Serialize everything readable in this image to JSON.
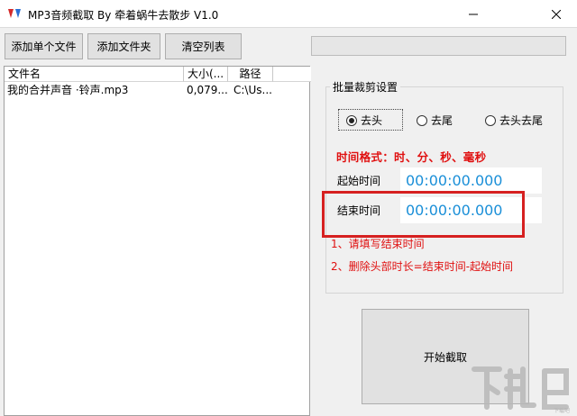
{
  "window": {
    "title": "MP3音频截取 By 牵着蜗牛去散步 V1.0"
  },
  "toolbar": {
    "add_file_label": "添加单个文件",
    "add_folder_label": "添加文件夹",
    "clear_list_label": "清空列表"
  },
  "progress": {
    "value": 0
  },
  "file_list": {
    "columns": [
      "文件名",
      "大小(...",
      "路径"
    ],
    "rows": [
      {
        "name": "我的合并声音 ·铃声.mp3",
        "size": "0,079....",
        "path": "C:\\Us..."
      }
    ]
  },
  "batch": {
    "group_title": "批量裁剪设置",
    "options": [
      "去头",
      "去尾",
      "去头去尾"
    ],
    "selected_option": "去头",
    "format_hint": "时间格式：时、分、秒、毫秒",
    "start_label": "起始时间",
    "start_value": "00:00:00.000",
    "end_label": "结束时间",
    "end_value": "00:00:00.000",
    "note1": "1、请填写结束时间",
    "note2": "2、删除头部时长=结束时间-起始时间"
  },
  "actions": {
    "start_label": "开始截取"
  },
  "watermark": {
    "text": "下载吧"
  },
  "colors": {
    "accent_red": "#e01010",
    "time_blue": "#1a8fd8",
    "highlight_red": "#d62020"
  }
}
